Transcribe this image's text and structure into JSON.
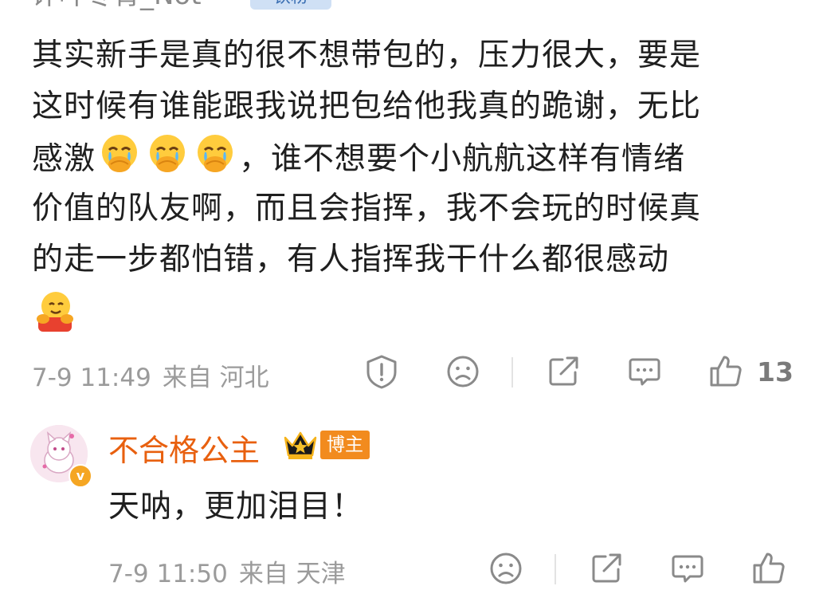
{
  "comment": {
    "username": "评叶冬青_Not",
    "user_tag": "铁粉",
    "text_lines": [
      "其实新手是真的很不想带包的，压力很大，要是",
      "这时候有谁能跟我说把包给他我真的跪谢，无比",
      "感激",
      "，谁不想要个小航航这样有情绪",
      "价值的队友啊，而且会指挥，我不会玩的时候真",
      "的走一步都怕错，有人指挥我干什么都很感动"
    ],
    "emojis": [
      "crying-hands-emoji",
      "crying-hands-emoji",
      "crying-hands-emoji",
      "hug-emoji"
    ],
    "time": "7-9 11:49",
    "source": "来自 河北",
    "like_count": "13"
  },
  "reply": {
    "username": "不合格公主",
    "badge": "博主",
    "text": "天呐，更加泪目！",
    "time": "7-9 11:50",
    "source": "来自 天津"
  },
  "icons": [
    "report-icon",
    "dislike-icon",
    "share-icon",
    "comment-icon",
    "like-icon",
    "verified-icon",
    "crown-icon"
  ],
  "colors": {
    "reply_name": "#e8600f",
    "badge_bg": "#f28b1e",
    "meta_text": "#9b9b9b"
  }
}
